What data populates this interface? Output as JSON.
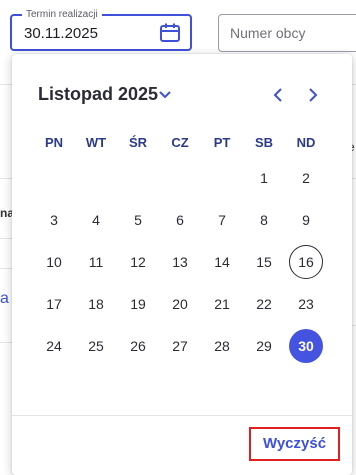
{
  "date_field": {
    "legend": "Termin realizacji",
    "value": "30.11.2025",
    "icon": "calendar-icon"
  },
  "second_field": {
    "placeholder": "Numer obcy"
  },
  "calendar": {
    "month_label": "Listopad 2025",
    "weekdays": [
      "PN",
      "WT",
      "ŚR",
      "CZ",
      "PT",
      "SB",
      "ND"
    ],
    "leading_blanks": 5,
    "days": [
      "1",
      "2",
      "3",
      "4",
      "5",
      "6",
      "7",
      "8",
      "9",
      "10",
      "11",
      "12",
      "13",
      "14",
      "15",
      "16",
      "17",
      "18",
      "19",
      "20",
      "21",
      "22",
      "23",
      "24",
      "25",
      "26",
      "27",
      "28",
      "29",
      "30"
    ],
    "today": "16",
    "selected": "30",
    "icons": {
      "month_dropdown": "chevron-down-icon",
      "prev": "chevron-left-icon",
      "next": "chevron-right-icon"
    },
    "accent_color": "#4454e0"
  },
  "footer": {
    "clear_label": "Wyczyść"
  },
  "background": {
    "fragment_1": "na",
    "fragment_2": "a",
    "fragment_3": "e"
  }
}
